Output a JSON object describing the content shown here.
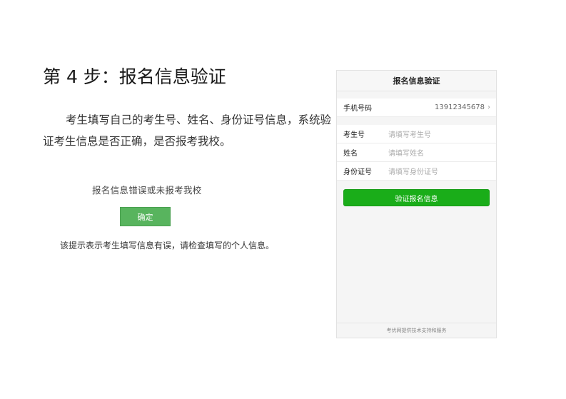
{
  "step": {
    "title": "第 4 步：报名信息验证"
  },
  "description": "考生填写自己的考生号、姓名、身份证号信息，系统验证考生信息是否正确，是否报考我校。",
  "dialog": {
    "message": "报名信息错误或未报考我校",
    "confirm_label": "确定"
  },
  "hint": "该提示表示考生填写信息有误，请检查填写的个人信息。",
  "phone": {
    "header_title": "报名信息验证",
    "mobile": {
      "label": "手机号码",
      "value": "13912345678"
    },
    "fields": [
      {
        "label": "考生号",
        "placeholder": "请填写考生号"
      },
      {
        "label": "姓名",
        "placeholder": "请填写姓名"
      },
      {
        "label": "身份证号",
        "placeholder": "请填写身份证号"
      }
    ],
    "verify_button": "验证报名信息",
    "footer": "考优网提供技术支持和服务"
  },
  "colors": {
    "primary_green": "#1aad19",
    "dialog_green": "#58b45e"
  },
  "icons": {
    "mobile_row": "chevron-right-icon"
  }
}
